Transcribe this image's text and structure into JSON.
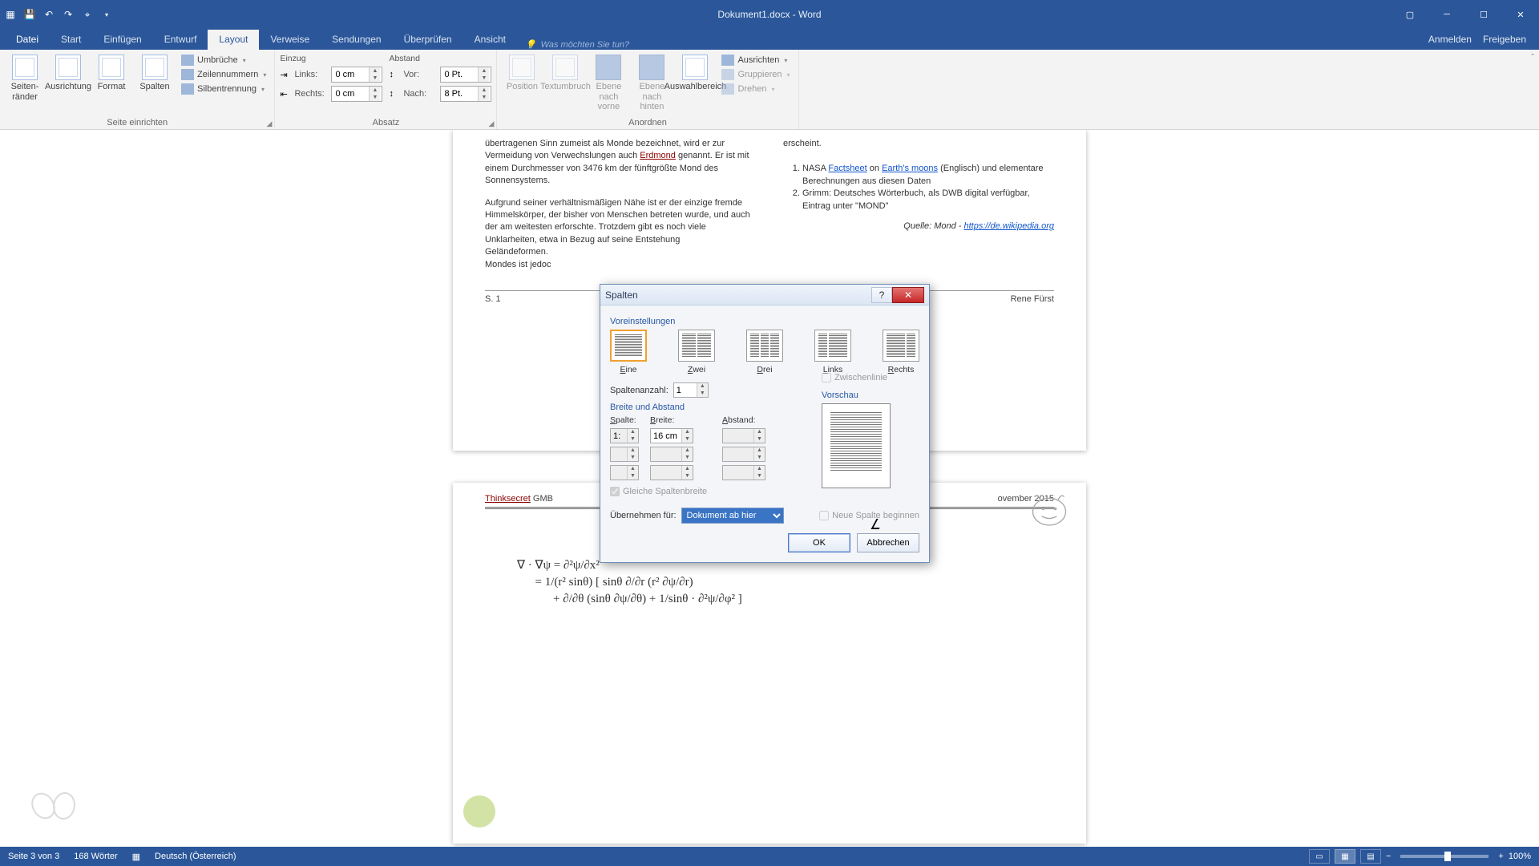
{
  "title": "Dokument1.docx - Word",
  "tabs": {
    "datei": "Datei",
    "start": "Start",
    "einfuegen": "Einfügen",
    "entwurf": "Entwurf",
    "layout": "Layout",
    "verweise": "Verweise",
    "sendungen": "Sendungen",
    "ueberpruefen": "Überprüfen",
    "ansicht": "Ansicht"
  },
  "tellme": "Was möchten Sie tun?",
  "account": {
    "signin": "Anmelden",
    "share": "Freigeben"
  },
  "ribbon": {
    "seitenraender": "Seiten-\nränder",
    "ausrichtung": "Ausrichtung",
    "format": "Format",
    "spalten": "Spalten",
    "umbrueche": "Umbrüche",
    "zeilennummern": "Zeilennummern",
    "silbentrennung": "Silbentrennung",
    "grp_seite": "Seite einrichten",
    "einzug": "Einzug",
    "links": "Links:",
    "rechts": "Rechts:",
    "links_v": "0 cm",
    "rechts_v": "0 cm",
    "abstand": "Abstand",
    "vor": "Vor:",
    "nach": "Nach:",
    "vor_v": "0 Pt.",
    "nach_v": "8 Pt.",
    "grp_absatz": "Absatz",
    "position": "Position",
    "textumbruch": "Textumbruch",
    "ebenenach_vorne": "Ebene nach\nvorne",
    "ebenenach_hinten": "Ebene nach\nhinten",
    "auswahlbereich": "Auswahlbereich",
    "ausrichten": "Ausrichten",
    "gruppieren": "Gruppieren",
    "drehen": "Drehen",
    "grp_anordnen": "Anordnen"
  },
  "doc": {
    "p1": "übertragenen Sinn zumeist als Monde bezeichnet, wird er zur Vermeidung von Verwechslungen auch ",
    "erd": "Erdmond",
    "p1b": " genannt. Er ist mit einem Durchmesser von 3476 km der fünftgrößte Mond des Sonnensystems.",
    "p2": "Aufgrund seiner verhältnismäßigen Nähe ist er der einzige fremde Himmelskörper, der bisher von Menschen betreten wurde, und auch der am weitesten erforschte. Trotzdem gibt es noch viele Unklarheiten, etwa in Bezug auf seine Entstehung",
    "p2b": "Geländeformen.",
    "p2c": "Mondes ist jedoc",
    "ersch": "erscheint.",
    "li1a": "NASA ",
    "fact": "Factsheet",
    "li1b": " on ",
    "earth": "Earth's ",
    "moons": "moons",
    "li1c": " (Englisch) und elementare Berechnungen aus diesen Daten",
    "li2": "Grimm: Deutsches Wörterbuch, als DWB digital verfügbar, Eintrag unter \"MOND\"",
    "src": "Quelle: Mond - ",
    "srclink": "https://de.wikipedia.org",
    "pgnum": "S. 1",
    "author": "Rene Fürst",
    "hdr_co": "Thinksecret",
    "hdr_co2": " GMB",
    "hdr_date": "ovember 2015"
  },
  "dlg": {
    "title": "Spalten",
    "voreinst": "Voreinstellungen",
    "presets": {
      "eins": "Eine",
      "zwei": "Zwei",
      "drei": "Drei",
      "links": "Links",
      "rechts": "Rechts"
    },
    "spaltenzahl": "Spaltenanzahl:",
    "spaltenzahl_v": "1",
    "zwischenlinie": "Zwischenlinie",
    "breiteabstand": "Breite und Abstand",
    "vorschau": "Vorschau",
    "spalte": "Spalte:",
    "breite": "Breite:",
    "abstand": "Abstand:",
    "row1_n": "1:",
    "row1_b": "16 cm",
    "gleich": "Gleiche Spaltenbreite",
    "uebernehmen": "Übernehmen für:",
    "uebernehmen_v": "Dokument ab hier",
    "neuespalte": "Neue Spalte beginnen",
    "ok": "OK",
    "cancel": "Abbrechen"
  },
  "status": {
    "page": "Seite 3 von 3",
    "words": "168 Wörter",
    "lang": "Deutsch (Österreich)",
    "zoom": "100%"
  }
}
